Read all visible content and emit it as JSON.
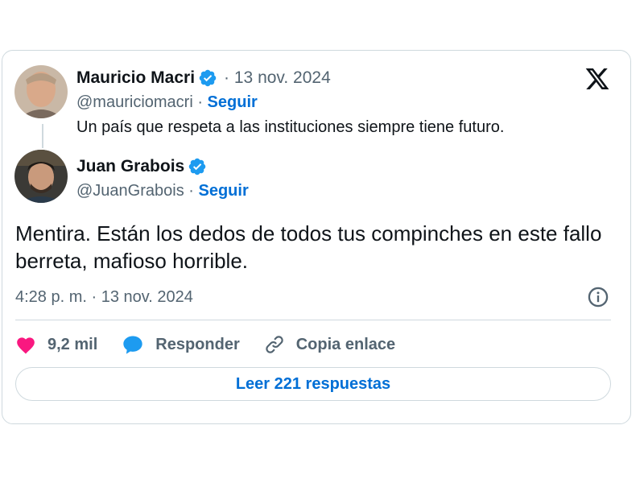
{
  "quoted_tweet": {
    "author_name": "Mauricio Macri",
    "date": "· 13 nov. 2024",
    "handle": "@mauriciomacri",
    "separator": " · ",
    "follow_label": "Seguir",
    "text": "Un país que respeta a las instituciones siempre tiene futuro."
  },
  "reply_tweet": {
    "author_name": "Juan Grabois",
    "handle": "@JuanGrabois",
    "separator": " · ",
    "follow_label": "Seguir",
    "text": "Mentira. Están los dedos de todos tus compinches en este fallo berreta, mafioso horrible.",
    "timestamp": "4:28 p. m. · 13 nov. 2024"
  },
  "actions": {
    "likes": "9,2 mil",
    "reply_label": "Responder",
    "copy_link_label": "Copia enlace"
  },
  "read_replies_label": "Leer 221 respuestas",
  "icons": {
    "brand": "x-logo-icon",
    "verified": "verified-badge-icon",
    "info": "info-icon",
    "like": "heart-icon",
    "reply": "speech-bubble-icon",
    "link": "link-icon"
  },
  "colors": {
    "accent_blue": "#006fd6",
    "verified_blue": "#1d9bf0",
    "like_pink": "#f91880",
    "secondary_text": "#536471",
    "border": "#cfd9de"
  }
}
